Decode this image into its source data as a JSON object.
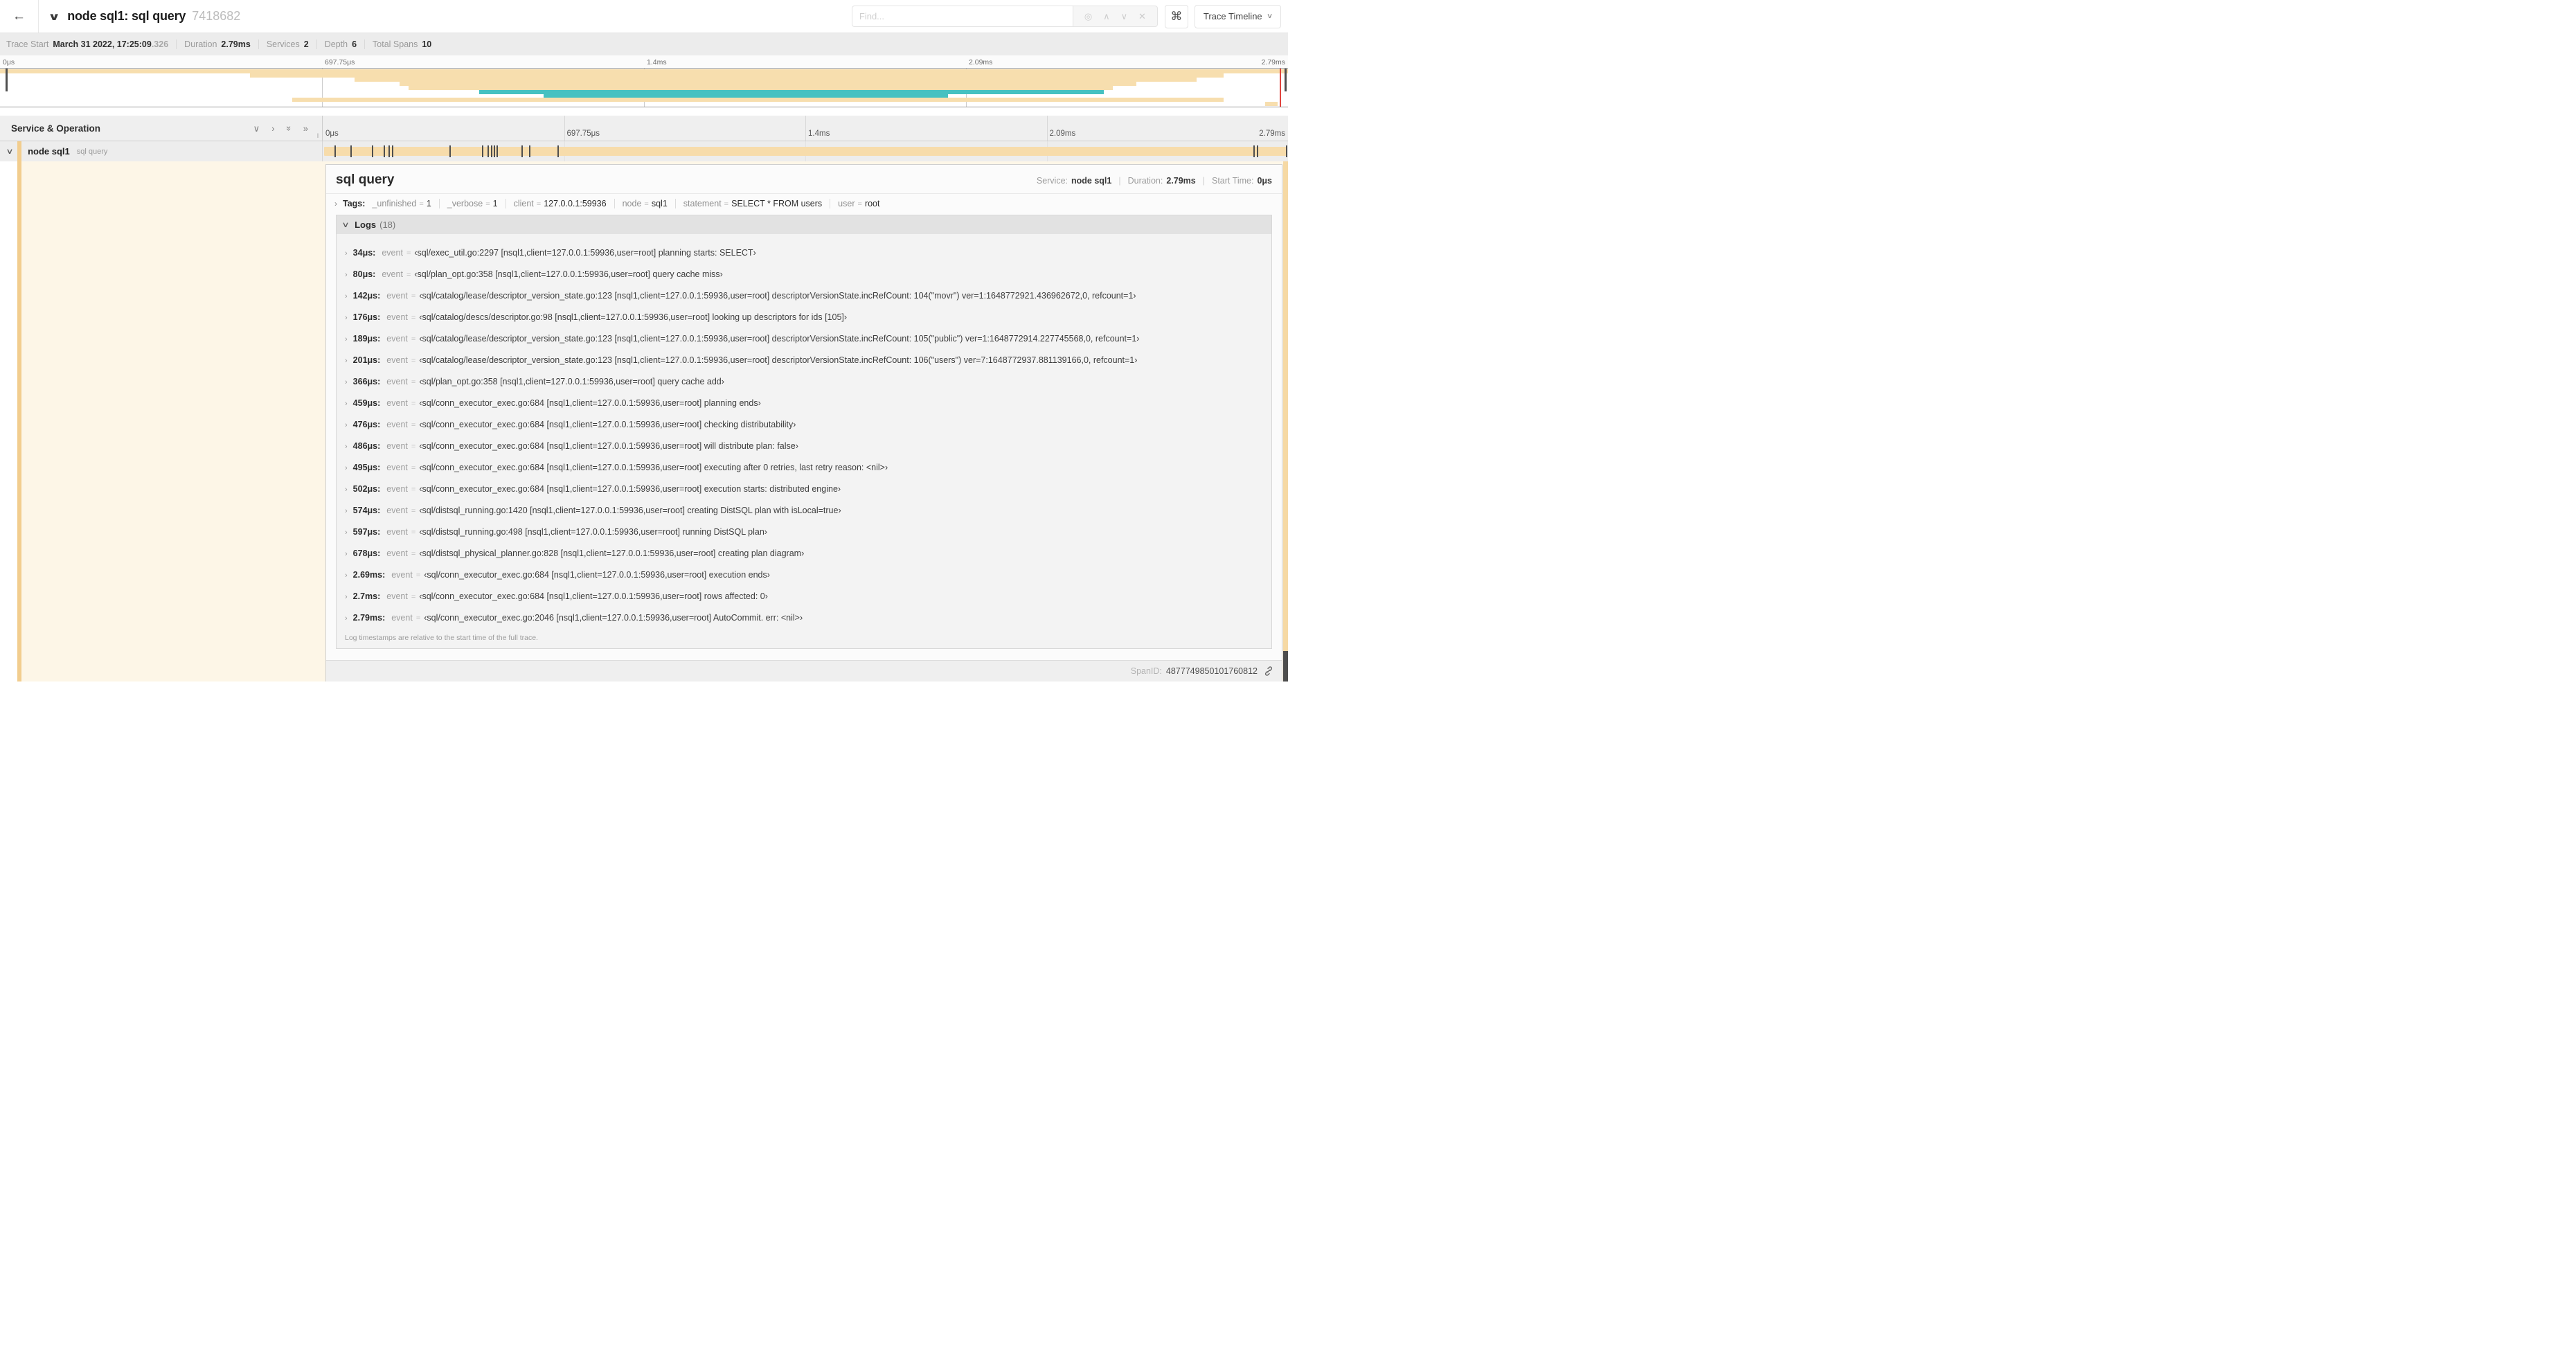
{
  "topnav": {
    "back_icon": "←",
    "collapse_icon": "∨",
    "title": "node sql1: sql query",
    "trace_id": "7418682",
    "find_placeholder": "Find...",
    "find_ops": {
      "target": "◎",
      "prev": "∧",
      "next": "∨",
      "clear": "✕"
    },
    "shortcut_button": "⌘",
    "view_button": {
      "label": "Trace Timeline",
      "chevron": "∨"
    }
  },
  "meta": {
    "items": [
      {
        "label": "Trace Start",
        "value": "March 31 2022, 17:25:09",
        "suffix": ".326"
      },
      {
        "label": "Duration",
        "value": "2.79ms",
        "suffix": ""
      },
      {
        "label": "Services",
        "value": "2",
        "suffix": ""
      },
      {
        "label": "Depth",
        "value": "6",
        "suffix": ""
      },
      {
        "label": "Total Spans",
        "value": "10",
        "suffix": ""
      }
    ]
  },
  "timeline": {
    "left_header": "Service & Operation",
    "header_icons": [
      "∨",
      "›",
      "»",
      "»"
    ],
    "axis_labels": [
      {
        "text": "0μs",
        "pos": 0
      },
      {
        "text": "697.75μs",
        "pos": 25
      },
      {
        "text": "1.4ms",
        "pos": 50
      },
      {
        "text": "2.09ms",
        "pos": 75
      },
      {
        "text": "2.79ms",
        "pos": 100
      }
    ],
    "gridlines_pct": [
      25,
      50,
      75
    ]
  },
  "minimap": {
    "colors": {
      "tan": "#f7deae",
      "teal": "#45c1c1",
      "red": "#e0443e"
    },
    "bars": [
      {
        "start": 0,
        "end": 100,
        "row": 0,
        "color": "tan"
      },
      {
        "start": 19.4,
        "end": 95.0,
        "row": 1,
        "color": "tan"
      },
      {
        "start": 27.5,
        "end": 92.9,
        "row": 2,
        "color": "tan"
      },
      {
        "start": 31.0,
        "end": 88.2,
        "row": 3,
        "color": "tan"
      },
      {
        "start": 31.7,
        "end": 86.4,
        "row": 4,
        "color": "tan"
      },
      {
        "start": 37.2,
        "end": 85.7,
        "row": 5,
        "color": "teal"
      },
      {
        "start": 42.2,
        "end": 73.6,
        "row": 6,
        "color": "teal"
      },
      {
        "start": 22.7,
        "end": 95.0,
        "row": 7,
        "color": "tan"
      },
      {
        "start": 98.2,
        "end": 99.2,
        "row": 8,
        "color": "tan"
      }
    ]
  },
  "span_row": {
    "collapse_icon": "∨",
    "service": "node sql1",
    "operation": "sql query",
    "bar_color": "#f7dcab",
    "accent_color": "#f2cd8e",
    "tint_color": "#fdf6e7",
    "strip_color": "#f6d9a4",
    "log_ticks_pct": [
      1.2,
      2.9,
      5.1,
      6.3,
      6.8,
      7.2,
      13.1,
      16.5,
      17.1,
      17.4,
      17.7,
      18.0,
      20.6,
      21.4,
      24.3,
      96.4,
      96.8,
      99.8
    ]
  },
  "detail": {
    "title": "sql query",
    "overview": {
      "service_label": "Service:",
      "service": "node sql1",
      "duration_label": "Duration:",
      "duration": "2.79ms",
      "start_label": "Start Time:",
      "start": "0μs"
    },
    "tags_label": "Tags:",
    "tags": [
      {
        "key": "_unfinished",
        "value": "1"
      },
      {
        "key": "_verbose",
        "value": "1"
      },
      {
        "key": "client",
        "value": "127.0.0.1:59936"
      },
      {
        "key": "node",
        "value": "sql1"
      },
      {
        "key": "statement",
        "value": "SELECT * FROM users"
      },
      {
        "key": "user",
        "value": "root"
      }
    ],
    "logs": {
      "label": "Logs",
      "count": "(18)",
      "field": "event",
      "entries": [
        {
          "ts": "34μs:",
          "msg": "‹sql/exec_util.go:2297 [nsql1,client=127.0.0.1:59936,user=root] planning starts: SELECT›"
        },
        {
          "ts": "80μs:",
          "msg": "‹sql/plan_opt.go:358 [nsql1,client=127.0.0.1:59936,user=root] query cache miss›"
        },
        {
          "ts": "142μs:",
          "msg": "‹sql/catalog/lease/descriptor_version_state.go:123 [nsql1,client=127.0.0.1:59936,user=root] descriptorVersionState.incRefCount: 104(\"movr\") ver=1:1648772921.436962672,0, refcount=1›"
        },
        {
          "ts": "176μs:",
          "msg": "‹sql/catalog/descs/descriptor.go:98 [nsql1,client=127.0.0.1:59936,user=root] looking up descriptors for ids [105]›"
        },
        {
          "ts": "189μs:",
          "msg": "‹sql/catalog/lease/descriptor_version_state.go:123 [nsql1,client=127.0.0.1:59936,user=root] descriptorVersionState.incRefCount: 105(\"public\") ver=1:1648772914.227745568,0, refcount=1›"
        },
        {
          "ts": "201μs:",
          "msg": "‹sql/catalog/lease/descriptor_version_state.go:123 [nsql1,client=127.0.0.1:59936,user=root] descriptorVersionState.incRefCount: 106(\"users\") ver=7:1648772937.881139166,0, refcount=1›"
        },
        {
          "ts": "366μs:",
          "msg": "‹sql/plan_opt.go:358 [nsql1,client=127.0.0.1:59936,user=root] query cache add›"
        },
        {
          "ts": "459μs:",
          "msg": "‹sql/conn_executor_exec.go:684 [nsql1,client=127.0.0.1:59936,user=root] planning ends›"
        },
        {
          "ts": "476μs:",
          "msg": "‹sql/conn_executor_exec.go:684 [nsql1,client=127.0.0.1:59936,user=root] checking distributability›"
        },
        {
          "ts": "486μs:",
          "msg": "‹sql/conn_executor_exec.go:684 [nsql1,client=127.0.0.1:59936,user=root] will distribute plan: false›"
        },
        {
          "ts": "495μs:",
          "msg": "‹sql/conn_executor_exec.go:684 [nsql1,client=127.0.0.1:59936,user=root] executing after 0 retries, last retry reason: <nil>›"
        },
        {
          "ts": "502μs:",
          "msg": "‹sql/conn_executor_exec.go:684 [nsql1,client=127.0.0.1:59936,user=root] execution starts: distributed engine›"
        },
        {
          "ts": "574μs:",
          "msg": "‹sql/distsql_running.go:1420 [nsql1,client=127.0.0.1:59936,user=root] creating DistSQL plan with isLocal=true›"
        },
        {
          "ts": "597μs:",
          "msg": "‹sql/distsql_running.go:498 [nsql1,client=127.0.0.1:59936,user=root] running DistSQL plan›"
        },
        {
          "ts": "678μs:",
          "msg": "‹sql/distsql_physical_planner.go:828 [nsql1,client=127.0.0.1:59936,user=root] creating plan diagram›"
        },
        {
          "ts": "2.69ms:",
          "msg": "‹sql/conn_executor_exec.go:684 [nsql1,client=127.0.0.1:59936,user=root] execution ends›"
        },
        {
          "ts": "2.7ms:",
          "msg": "‹sql/conn_executor_exec.go:684 [nsql1,client=127.0.0.1:59936,user=root] rows affected: 0›"
        },
        {
          "ts": "2.79ms:",
          "msg": "‹sql/conn_executor_exec.go:2046 [nsql1,client=127.0.0.1:59936,user=root] AutoCommit. err: <nil>›"
        }
      ]
    },
    "note": "Log timestamps are relative to the start time of the full trace.",
    "footer": {
      "label": "SpanID:",
      "value": "4877749850101760812"
    }
  }
}
